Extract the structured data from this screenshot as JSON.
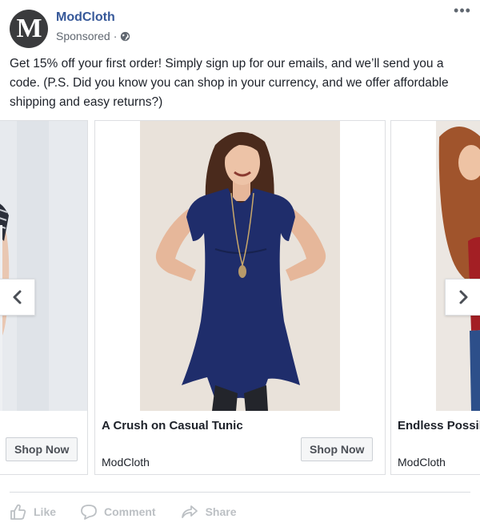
{
  "post": {
    "avatar_letter": "M",
    "page_name": "ModCloth",
    "meta_text": "Sponsored",
    "meta_dot": "·",
    "caption": "Get 15% off your first order! Simply sign up for our emails, and we’ll send you a code. (P.S. Did you know you can shop in your currency, and we offer affordable shipping and easy returns?)"
  },
  "carousel": {
    "cards": [
      {
        "title": "",
        "brand": "",
        "cta": "Shop Now"
      },
      {
        "title": "A Crush on Casual Tunic",
        "brand": "ModCloth",
        "cta": "Shop Now"
      },
      {
        "title": "Endless Possil",
        "brand": "ModCloth",
        "cta": ""
      }
    ]
  },
  "actions": {
    "like": "Like",
    "comment": "Comment",
    "share": "Share"
  },
  "colors": {
    "link_blue": "#365899",
    "tunic_navy": "#1f2d6b",
    "muted_gray": "#bcc0c4"
  },
  "icons": [
    "globe-icon",
    "more-icon",
    "chevron-left-icon",
    "chevron-right-icon",
    "like-icon",
    "comment-icon",
    "share-icon"
  ]
}
